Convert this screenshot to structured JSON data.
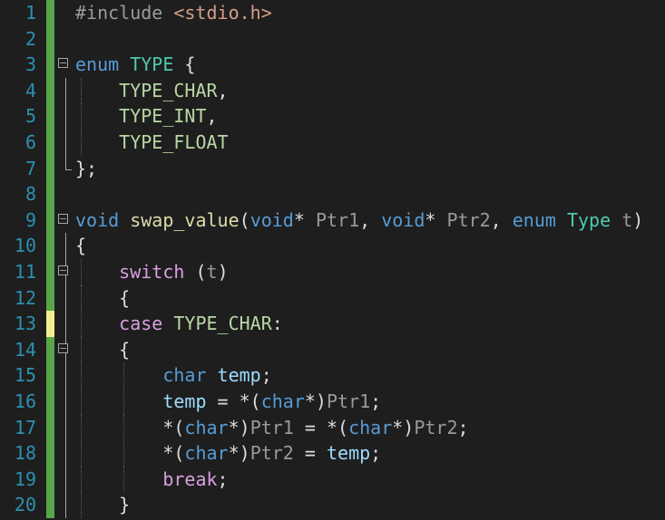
{
  "editor": {
    "colors": {
      "background": "#1e1e1e",
      "line_number": "#2b91af",
      "change_saved": "#57a64a",
      "change_unsaved": "#efef91",
      "keyword": "#569cd6",
      "control_keyword": "#d8a0df",
      "type_name": "#4ec9b0",
      "enum_member": "#b8d7a3",
      "function": "#dcdcaa",
      "local_variable": "#9cdcfe",
      "parameter": "#9a9a9a",
      "string": "#d69d85",
      "plain": "#dcdcdc"
    },
    "lines": [
      {
        "num": "1",
        "change": "saved",
        "fold": "none",
        "guides": 0,
        "tokens": [
          {
            "t": "#include ",
            "k": "pre"
          },
          {
            "t": "<stdio.h>",
            "k": "string"
          }
        ]
      },
      {
        "num": "2",
        "change": "saved",
        "fold": "none",
        "guides": 0,
        "tokens": []
      },
      {
        "num": "3",
        "change": "saved",
        "fold": "start",
        "guides": 0,
        "tokens": [
          {
            "t": "enum",
            "k": "keyword"
          },
          {
            "t": " ",
            "k": "plain"
          },
          {
            "t": "TYPE",
            "k": "type"
          },
          {
            "t": " {",
            "k": "plain"
          }
        ]
      },
      {
        "num": "4",
        "change": "saved",
        "fold": "line",
        "guides": 1,
        "tokens": [
          {
            "t": "    ",
            "k": "plain"
          },
          {
            "t": "TYPE_CHAR",
            "k": "enum"
          },
          {
            "t": ",",
            "k": "plain"
          }
        ]
      },
      {
        "num": "5",
        "change": "saved",
        "fold": "line",
        "guides": 1,
        "tokens": [
          {
            "t": "    ",
            "k": "plain"
          },
          {
            "t": "TYPE_INT",
            "k": "enum"
          },
          {
            "t": ",",
            "k": "plain"
          }
        ]
      },
      {
        "num": "6",
        "change": "saved",
        "fold": "line",
        "guides": 1,
        "tokens": [
          {
            "t": "    ",
            "k": "plain"
          },
          {
            "t": "TYPE_FLOAT",
            "k": "enum"
          }
        ]
      },
      {
        "num": "7",
        "change": "saved",
        "fold": "end",
        "guides": 0,
        "tokens": [
          {
            "t": "};",
            "k": "plain"
          }
        ]
      },
      {
        "num": "8",
        "change": "saved",
        "fold": "none",
        "guides": 0,
        "tokens": []
      },
      {
        "num": "9",
        "change": "saved",
        "fold": "start",
        "guides": 0,
        "tokens": [
          {
            "t": "void",
            "k": "keyword"
          },
          {
            "t": " ",
            "k": "plain"
          },
          {
            "t": "swap_value",
            "k": "func"
          },
          {
            "t": "(",
            "k": "plain"
          },
          {
            "t": "void",
            "k": "keyword"
          },
          {
            "t": "* ",
            "k": "plain"
          },
          {
            "t": "Ptr1",
            "k": "param"
          },
          {
            "t": ", ",
            "k": "plain"
          },
          {
            "t": "void",
            "k": "keyword"
          },
          {
            "t": "* ",
            "k": "plain"
          },
          {
            "t": "Ptr2",
            "k": "param"
          },
          {
            "t": ", ",
            "k": "plain"
          },
          {
            "t": "enum",
            "k": "keyword"
          },
          {
            "t": " ",
            "k": "plain"
          },
          {
            "t": "Type",
            "k": "type"
          },
          {
            "t": " ",
            "k": "plain"
          },
          {
            "t": "t",
            "k": "param"
          },
          {
            "t": ")",
            "k": "plain"
          }
        ]
      },
      {
        "num": "10",
        "change": "saved",
        "fold": "line",
        "guides": 0,
        "tokens": [
          {
            "t": "{",
            "k": "plain"
          }
        ]
      },
      {
        "num": "11",
        "change": "saved",
        "fold": "start",
        "guides": 1,
        "tokens": [
          {
            "t": "    ",
            "k": "plain"
          },
          {
            "t": "switch",
            "k": "control"
          },
          {
            "t": " (",
            "k": "plain"
          },
          {
            "t": "t",
            "k": "param"
          },
          {
            "t": ")",
            "k": "plain"
          }
        ]
      },
      {
        "num": "12",
        "change": "saved",
        "fold": "line",
        "guides": 1,
        "tokens": [
          {
            "t": "    {",
            "k": "plain"
          }
        ]
      },
      {
        "num": "13",
        "change": "unsaved",
        "fold": "line",
        "guides": 1,
        "tokens": [
          {
            "t": "    ",
            "k": "plain"
          },
          {
            "t": "case",
            "k": "control"
          },
          {
            "t": " ",
            "k": "plain"
          },
          {
            "t": "TYPE_CHAR",
            "k": "enum"
          },
          {
            "t": ":",
            "k": "plain"
          }
        ]
      },
      {
        "num": "14",
        "change": "saved",
        "fold": "start",
        "guides": 1,
        "tokens": [
          {
            "t": "    {",
            "k": "plain"
          }
        ]
      },
      {
        "num": "15",
        "change": "saved",
        "fold": "line",
        "guides": 2,
        "tokens": [
          {
            "t": "        ",
            "k": "plain"
          },
          {
            "t": "char",
            "k": "keyword"
          },
          {
            "t": " ",
            "k": "plain"
          },
          {
            "t": "temp",
            "k": "local"
          },
          {
            "t": ";",
            "k": "plain"
          }
        ]
      },
      {
        "num": "16",
        "change": "saved",
        "fold": "line",
        "guides": 2,
        "tokens": [
          {
            "t": "        ",
            "k": "plain"
          },
          {
            "t": "temp",
            "k": "local"
          },
          {
            "t": " = *(",
            "k": "plain"
          },
          {
            "t": "char",
            "k": "keyword"
          },
          {
            "t": "*)",
            "k": "plain"
          },
          {
            "t": "Ptr1",
            "k": "param"
          },
          {
            "t": ";",
            "k": "plain"
          }
        ]
      },
      {
        "num": "17",
        "change": "saved",
        "fold": "line",
        "guides": 2,
        "tokens": [
          {
            "t": "        *(",
            "k": "plain"
          },
          {
            "t": "char",
            "k": "keyword"
          },
          {
            "t": "*)",
            "k": "plain"
          },
          {
            "t": "Ptr1",
            "k": "param"
          },
          {
            "t": " = *(",
            "k": "plain"
          },
          {
            "t": "char",
            "k": "keyword"
          },
          {
            "t": "*)",
            "k": "plain"
          },
          {
            "t": "Ptr2",
            "k": "param"
          },
          {
            "t": ";",
            "k": "plain"
          }
        ]
      },
      {
        "num": "18",
        "change": "saved",
        "fold": "line",
        "guides": 2,
        "tokens": [
          {
            "t": "        *(",
            "k": "plain"
          },
          {
            "t": "char",
            "k": "keyword"
          },
          {
            "t": "*)",
            "k": "plain"
          },
          {
            "t": "Ptr2",
            "k": "param"
          },
          {
            "t": " = ",
            "k": "plain"
          },
          {
            "t": "temp",
            "k": "local"
          },
          {
            "t": ";",
            "k": "plain"
          }
        ]
      },
      {
        "num": "19",
        "change": "saved",
        "fold": "line",
        "guides": 2,
        "tokens": [
          {
            "t": "        ",
            "k": "plain"
          },
          {
            "t": "break",
            "k": "control"
          },
          {
            "t": ";",
            "k": "plain"
          }
        ]
      },
      {
        "num": "20",
        "change": "saved",
        "fold": "line",
        "guides": 1,
        "tokens": [
          {
            "t": "    }",
            "k": "plain"
          }
        ]
      }
    ]
  }
}
